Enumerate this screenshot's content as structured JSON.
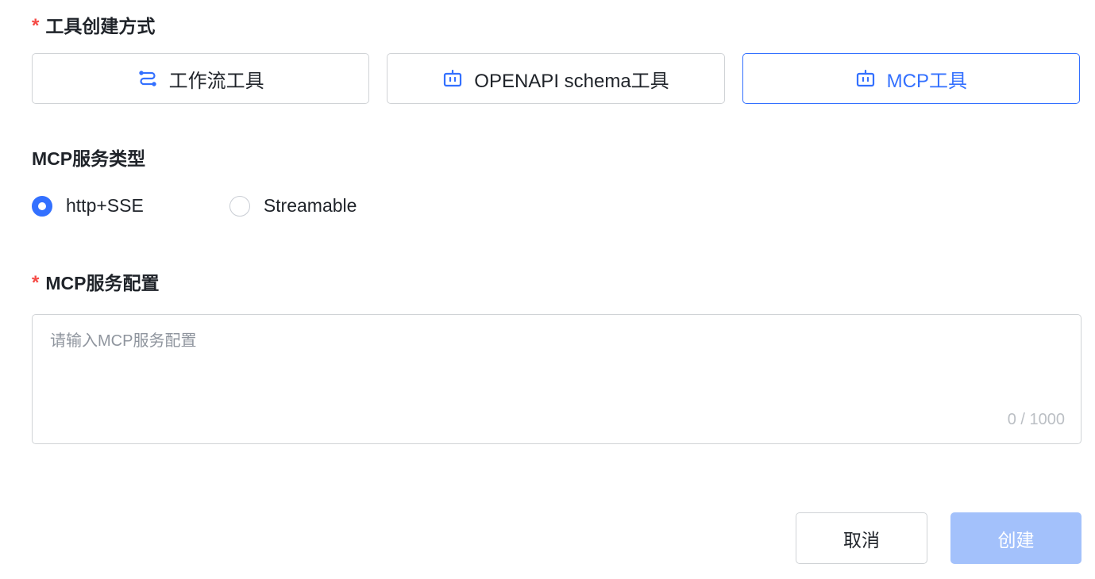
{
  "creation_method": {
    "label": "工具创建方式",
    "required_mark": "*",
    "options": [
      {
        "label": "工作流工具",
        "icon": "workflow-icon",
        "selected": false
      },
      {
        "label": "OPENAPI schema工具",
        "icon": "robot-icon",
        "selected": false
      },
      {
        "label": "MCP工具",
        "icon": "robot-icon",
        "selected": true
      }
    ]
  },
  "service_type": {
    "label": "MCP服务类型",
    "options": [
      {
        "label": "http+SSE",
        "checked": true
      },
      {
        "label": "Streamable",
        "checked": false
      }
    ]
  },
  "service_config": {
    "label": "MCP服务配置",
    "required_mark": "*",
    "placeholder": "请输入MCP服务配置",
    "value": "",
    "char_count": "0 / 1000"
  },
  "actions": {
    "cancel_label": "取消",
    "create_label": "创建"
  },
  "colors": {
    "accent": "#3370ff",
    "required": "#f54a45",
    "create_disabled": "#a3c1fb"
  }
}
